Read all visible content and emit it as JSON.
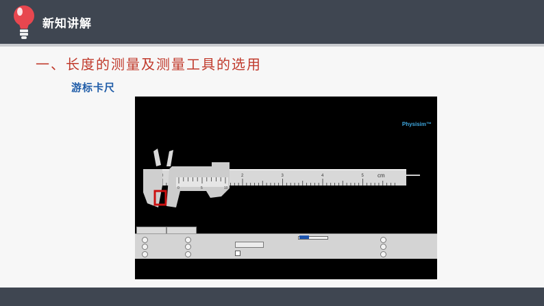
{
  "header": {
    "title": "新知讲解",
    "bulb_color": "#e8474f"
  },
  "slide": {
    "section_heading": "一、长度的测量及测量工具的选用",
    "sub_heading": "游标卡尺"
  },
  "simulation": {
    "brand": "Physisim™",
    "scale_unit": "cm",
    "scale_numbers": [
      "0",
      "1",
      "2",
      "3",
      "4",
      "5"
    ],
    "vernier_numbers": [
      "0",
      "5",
      "10"
    ],
    "tabs": [
      "",
      ""
    ],
    "control_button": "",
    "accent_color": "#1c54b0"
  }
}
